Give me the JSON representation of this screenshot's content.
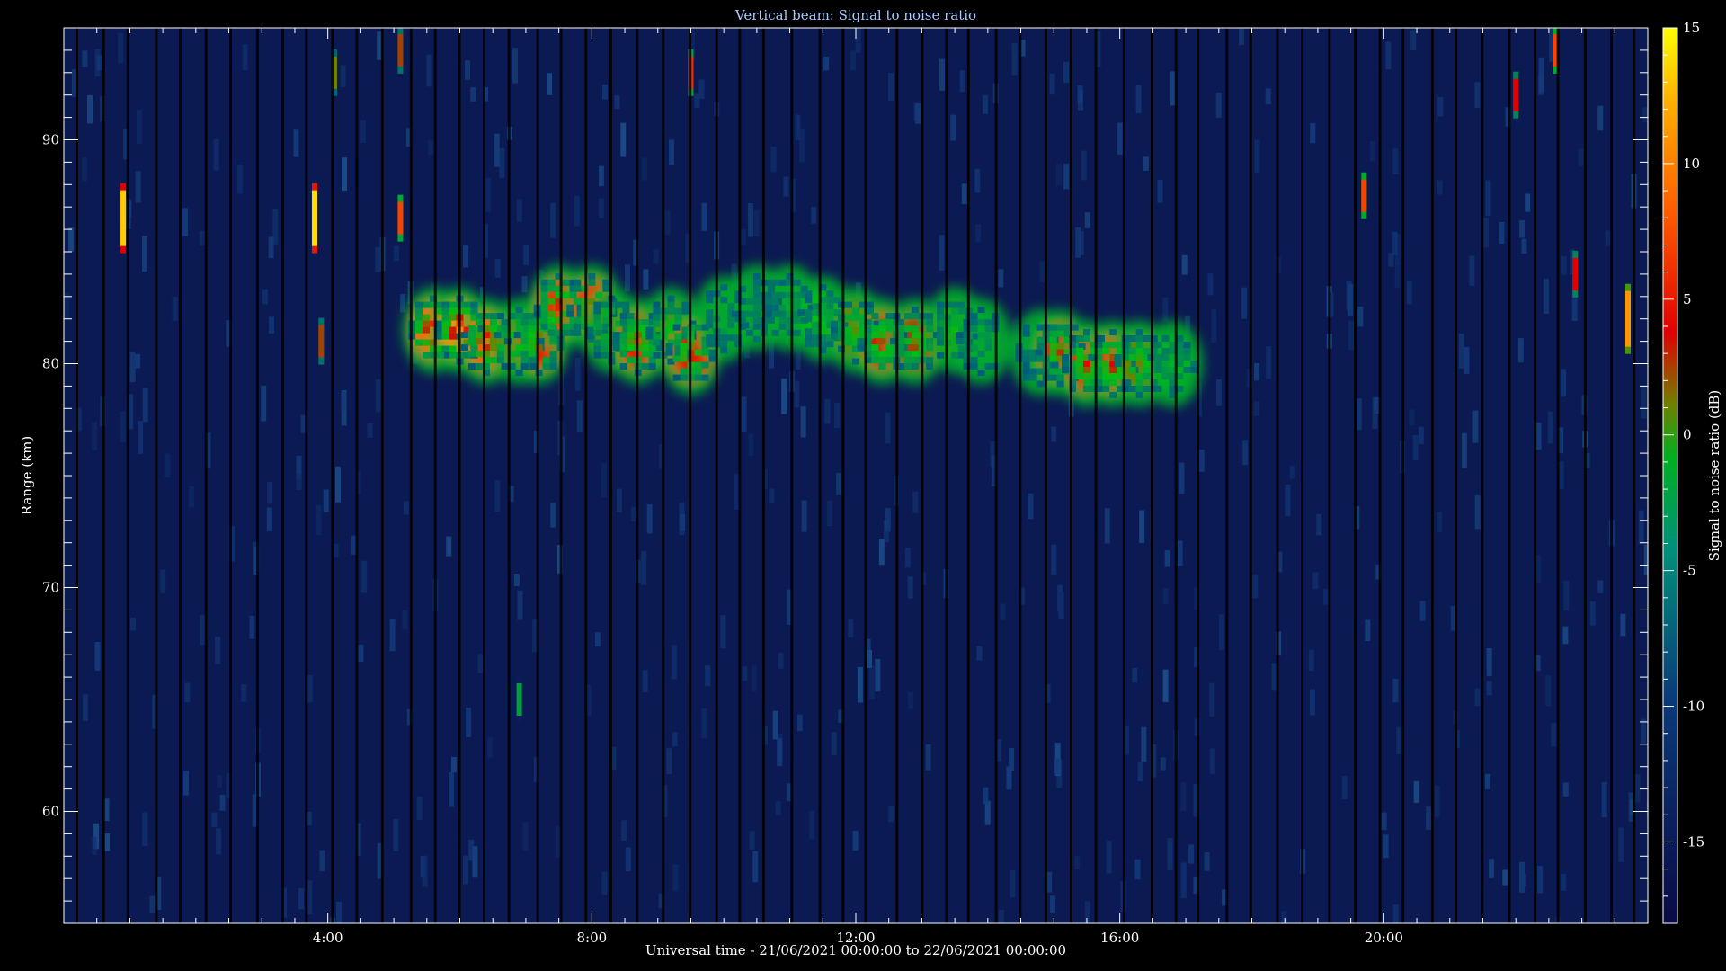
{
  "chart_data": {
    "type": "heatmap",
    "title": "Vertical beam: Signal to noise ratio",
    "xlabel": "Universal time - 21/06/2021 00:00:00 to 22/06/2021 00:00:00",
    "ylabel": "Range (km)",
    "colorbar_label": "Signal to noise ratio (dB)",
    "x_range_hours": [
      0,
      24
    ],
    "y_range_km": [
      55,
      95
    ],
    "colorbar_range_db": [
      -18,
      15
    ],
    "x_ticks": [
      {
        "value": 4,
        "label": "4:00"
      },
      {
        "value": 8,
        "label": "8:00"
      },
      {
        "value": 12,
        "label": "12:00"
      },
      {
        "value": 16,
        "label": "16:00"
      },
      {
        "value": 20,
        "label": "20:00"
      }
    ],
    "y_ticks": [
      {
        "value": 60,
        "label": "60"
      },
      {
        "value": 70,
        "label": "70"
      },
      {
        "value": 80,
        "label": "80"
      },
      {
        "value": 90,
        "label": "90"
      }
    ],
    "colorbar_ticks": [
      {
        "value": -15,
        "label": "-15"
      },
      {
        "value": -10,
        "label": "-10"
      },
      {
        "value": -5,
        "label": "-5"
      },
      {
        "value": 0,
        "label": "0"
      },
      {
        "value": 5,
        "label": "5"
      },
      {
        "value": 10,
        "label": "10"
      },
      {
        "value": 15,
        "label": "15"
      }
    ],
    "background_snr_db": -16,
    "echo_layer": [
      {
        "t": 5.6,
        "km": 81.5,
        "db": 7
      },
      {
        "t": 6.0,
        "km": 81.5,
        "db": 9
      },
      {
        "t": 6.4,
        "km": 81.0,
        "db": 6
      },
      {
        "t": 6.9,
        "km": 81.0,
        "db": 0
      },
      {
        "t": 7.2,
        "km": 81.0,
        "db": 3
      },
      {
        "t": 7.5,
        "km": 82.5,
        "db": 4
      },
      {
        "t": 8.0,
        "km": 82.5,
        "db": 4
      },
      {
        "t": 8.3,
        "km": 81.5,
        "db": -1
      },
      {
        "t": 8.7,
        "km": 81.0,
        "db": 3
      },
      {
        "t": 9.2,
        "km": 81.5,
        "db": -1
      },
      {
        "t": 9.5,
        "km": 80.5,
        "db": 3
      },
      {
        "t": 10.0,
        "km": 82.0,
        "db": -5
      },
      {
        "t": 10.5,
        "km": 82.5,
        "db": -6
      },
      {
        "t": 11.0,
        "km": 82.5,
        "db": -5
      },
      {
        "t": 11.5,
        "km": 82.0,
        "db": -3
      },
      {
        "t": 12.0,
        "km": 81.5,
        "db": 0
      },
      {
        "t": 12.4,
        "km": 81.0,
        "db": 2
      },
      {
        "t": 12.9,
        "km": 81.0,
        "db": 1
      },
      {
        "t": 13.5,
        "km": 81.5,
        "db": -2
      },
      {
        "t": 13.9,
        "km": 81.0,
        "db": -5
      },
      {
        "t": 14.8,
        "km": 80.5,
        "db": -6
      },
      {
        "t": 15.1,
        "km": 80.5,
        "db": 2
      },
      {
        "t": 15.5,
        "km": 80.0,
        "db": 3
      },
      {
        "t": 15.9,
        "km": 80.0,
        "db": 4
      },
      {
        "t": 16.3,
        "km": 80.0,
        "db": 0
      },
      {
        "t": 16.8,
        "km": 80.0,
        "db": -4
      }
    ],
    "meteor_streaks": [
      {
        "t": 0.9,
        "km": 86.5,
        "db": 12
      },
      {
        "t": 3.8,
        "km": 86.5,
        "db": 13
      },
      {
        "t": 3.9,
        "km": 81.0,
        "db": 1
      },
      {
        "t": 4.1,
        "km": 93.0,
        "db": 0
      },
      {
        "t": 5.1,
        "km": 86.5,
        "db": 5
      },
      {
        "t": 5.1,
        "km": 94.0,
        "db": 1
      },
      {
        "t": 9.5,
        "km": 93.0,
        "db": 4
      },
      {
        "t": 6.9,
        "km": 65.0,
        "db": -6
      },
      {
        "t": 19.7,
        "km": 87.5,
        "db": 5
      },
      {
        "t": 22.0,
        "km": 92.0,
        "db": 2
      },
      {
        "t": 22.6,
        "km": 94.0,
        "db": 5
      },
      {
        "t": 22.9,
        "km": 84.0,
        "db": 2
      },
      {
        "t": 23.7,
        "km": 82.0,
        "db": 9
      }
    ]
  }
}
